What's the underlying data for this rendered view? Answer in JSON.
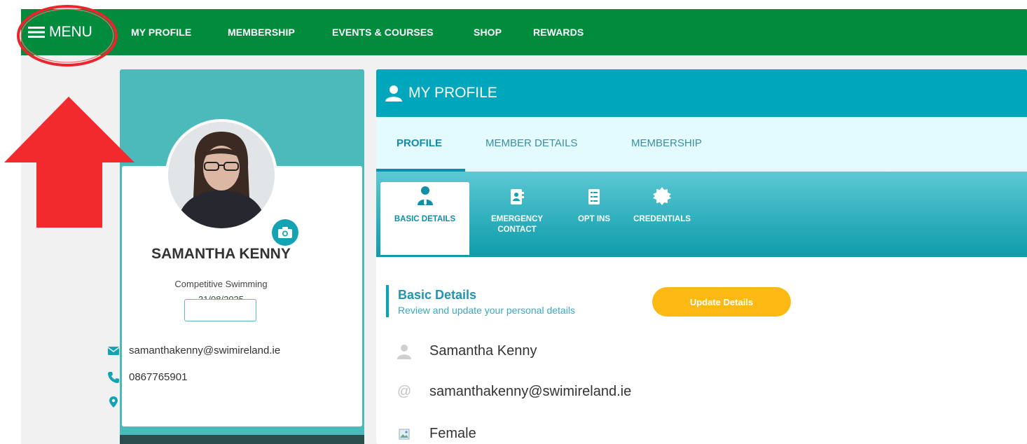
{
  "topnav": {
    "menu_label": "MENU",
    "links": [
      "MY PROFILE",
      "MEMBERSHIP",
      "EVENTS & COURSES",
      "SHOP",
      "REWARDS"
    ]
  },
  "profile_card": {
    "name": "SAMANTHA KENNY",
    "membership_type": "Competitive Swimming",
    "expiry_date": "31/08/2025",
    "email": "samanthakenny@swimireland.ie",
    "phone": "0867765901",
    "location": ""
  },
  "panel": {
    "title": "MY PROFILE",
    "tabs": [
      "PROFILE",
      "MEMBER DETAILS",
      "MEMBERSHIP"
    ],
    "active_tab": "PROFILE",
    "subtabs": [
      "BASIC DETAILS",
      "EMERGENCY CONTACT",
      "OPT INS",
      "CREDENTIALS"
    ],
    "active_subtab": "BASIC DETAILS",
    "section_title": "Basic Details",
    "section_subtitle": "Review and update your personal details",
    "update_button": "Update Details",
    "details": {
      "name": "Samantha Kenny",
      "email": "samanthakenny@swimireland.ie",
      "gender": "Female"
    }
  },
  "colors": {
    "nav_green": "#008c3c",
    "teal_header": "#00a6bb",
    "card_teal": "#4cbaba",
    "accent_yellow": "#fdb913",
    "annotation_red": "#e8262b"
  },
  "icons": {
    "menu": "hamburger-icon",
    "profile": "user-icon",
    "camera": "camera-icon",
    "email": "envelope-icon",
    "phone": "phone-icon",
    "location": "map-pin-icon",
    "basic_details": "person-tie-icon",
    "emergency_contact": "contact-card-icon",
    "opt_ins": "checklist-icon",
    "credentials": "badge-icon",
    "detail_name": "person-icon",
    "detail_email": "at-icon",
    "detail_gender": "broken-image-icon"
  }
}
